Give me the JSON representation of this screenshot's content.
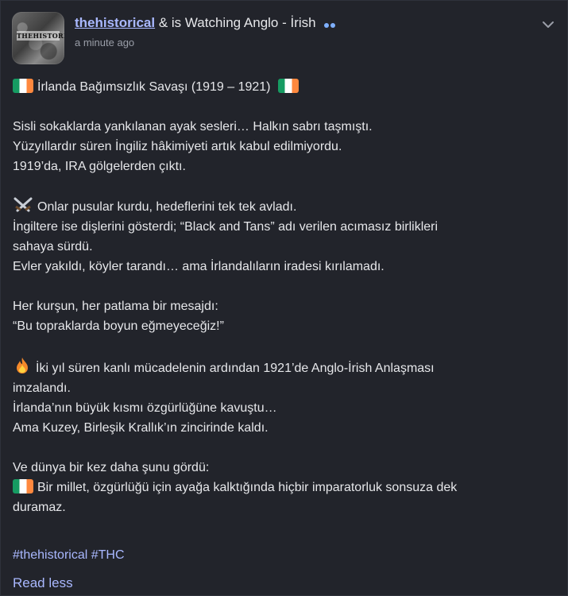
{
  "post": {
    "username": "thehistorical",
    "activity": "& is Watching Anglo - İrish",
    "timestamp": "a minute ago",
    "avatar_text": "THEHISTORICAL"
  },
  "body": {
    "title": "İrlanda Bağımsızlık Savaşı (1919 – 1921)",
    "p1": [
      "Sisli sokaklarda yankılanan ayak sesleri… Halkın sabrı taşmıştı.",
      "Yüzyıllardır süren İngiliz hâkimiyeti artık kabul edilmiyordu.",
      "1919’da, IRA gölgelerden çıktı."
    ],
    "p2": [
      "Onlar pusular kurdu, hedeflerini tek tek avladı.",
      "İngiltere ise dişlerini gösterdi; “Black and Tans” adı verilen acımasız birlikleri",
      "sahaya sürdü.",
      "Evler yakıldı, köyler tarandı… ama İrlandalıların iradesi kırılamadı."
    ],
    "p3": [
      "Her kurşun, her patlama bir mesajdı:",
      "“Bu topraklarda boyun eğmeyeceğiz!”"
    ],
    "p4": [
      "İki yıl süren kanlı mücadelenin ardından 1921’de Anglo-İrish Anlaşması",
      "imzalandı.",
      "İrlanda’nın büyük kısmı özgürlüğüne kavuştu…",
      "Ama Kuzey, Birleşik Krallık’ın zincirinde kaldı."
    ],
    "p5": [
      "Ve dünya bir kez daha şunu gördü:",
      "Bir millet, özgürlüğü için ayağa kalktığında hiçbir imparatorluk sonsuza dek",
      "duramaz."
    ],
    "hashtags": [
      "#thehistorical",
      "#THC"
    ],
    "read_less": "Read less"
  }
}
